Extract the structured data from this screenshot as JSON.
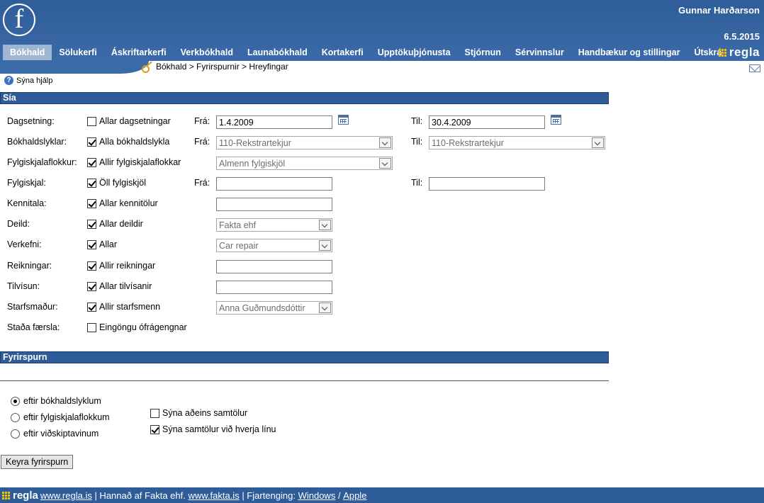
{
  "header": {
    "logo_letter": "f",
    "user_name": "Gunnar Harðarson",
    "date": "6.5.2015",
    "brand": "regla"
  },
  "nav": {
    "items": [
      {
        "label": "Bókhald"
      },
      {
        "label": "Sölukerfi"
      },
      {
        "label": "Áskriftarkerfi"
      },
      {
        "label": "Verkbókhald"
      },
      {
        "label": "Launabókhald"
      },
      {
        "label": "Kortakerfi"
      },
      {
        "label": "Upptökuþjónusta"
      },
      {
        "label": "Stjórnun"
      },
      {
        "label": "Sérvinnslur"
      },
      {
        "label": "Handbækur og stillingar"
      },
      {
        "label": "Útskrá"
      }
    ],
    "active": "Bókhald"
  },
  "breadcrumb": "Bókhald > Fyrirspurnir > Hreyfingar",
  "help_label": "Sýna hjálp",
  "filter": {
    "title": "Sía",
    "from_label": "Frá:",
    "to_label": "Til:",
    "date": {
      "label": "Dagsetning:",
      "check_label": "Allar dagsetningar",
      "checked": false,
      "from": "1.4.2009",
      "to": "30.4.2009"
    },
    "accounts": {
      "label": "Bókhaldslyklar:",
      "check_label": "Alla bókhaldslykla",
      "checked": true,
      "from": "110-Rekstrartekjur",
      "to": "110-Rekstrartekjur"
    },
    "doc_categories": {
      "label": "Fylgiskjalaflokkur:",
      "check_label": "Allir fylgiskjalaflokkar",
      "checked": true,
      "value": "Almenn fylgiskjöl"
    },
    "documents": {
      "label": "Fylgiskjal:",
      "check_label": "Öll fylgiskjöl",
      "checked": true,
      "from": "",
      "to": ""
    },
    "id_number": {
      "label": "Kennitala:",
      "check_label": "Allar kennitölur",
      "checked": true,
      "value": ""
    },
    "department": {
      "label": "Deild:",
      "check_label": "Allar deildir",
      "checked": true,
      "value": "Fakta ehf"
    },
    "project": {
      "label": "Verkefni:",
      "check_label": "Allar",
      "checked": true,
      "value": "Car repair"
    },
    "invoices": {
      "label": "Reikningar:",
      "check_label": "Allir reikningar",
      "checked": true,
      "value": ""
    },
    "reference": {
      "label": "Tilvísun:",
      "check_label": "Allar tilvísanir",
      "checked": true,
      "value": ""
    },
    "employee": {
      "label": "Starfsmaður:",
      "check_label": "Allir starfsmenn",
      "checked": true,
      "value": "Anna Guðmundsdóttir"
    },
    "status": {
      "label": "Staða færsla:",
      "check_label": "Eingöngu ófrágengnar",
      "checked": false
    }
  },
  "query": {
    "title": "Fyrirspurn",
    "radios": [
      {
        "label": "eftir bókhaldslyklum",
        "selected": true
      },
      {
        "label": "eftir fylgiskjalaflokkum",
        "selected": false
      },
      {
        "label": "eftir viðskiptavinum",
        "selected": false
      }
    ],
    "options": [
      {
        "label": "Sýna aðeins samtölur",
        "checked": false
      },
      {
        "label": "Sýna samtölur við hverja línu",
        "checked": true
      }
    ],
    "run_label": "Keyra fyrirspurn"
  },
  "footer": {
    "brand": "regla",
    "site_link": "www.regla.is",
    "made_by": " | Hannað af Fakta ehf. ",
    "fakta_link": "www.fakta.is",
    "remote": " | Fjartenging: ",
    "windows": "Windows",
    "slash": " / ",
    "apple": "Apple"
  }
}
